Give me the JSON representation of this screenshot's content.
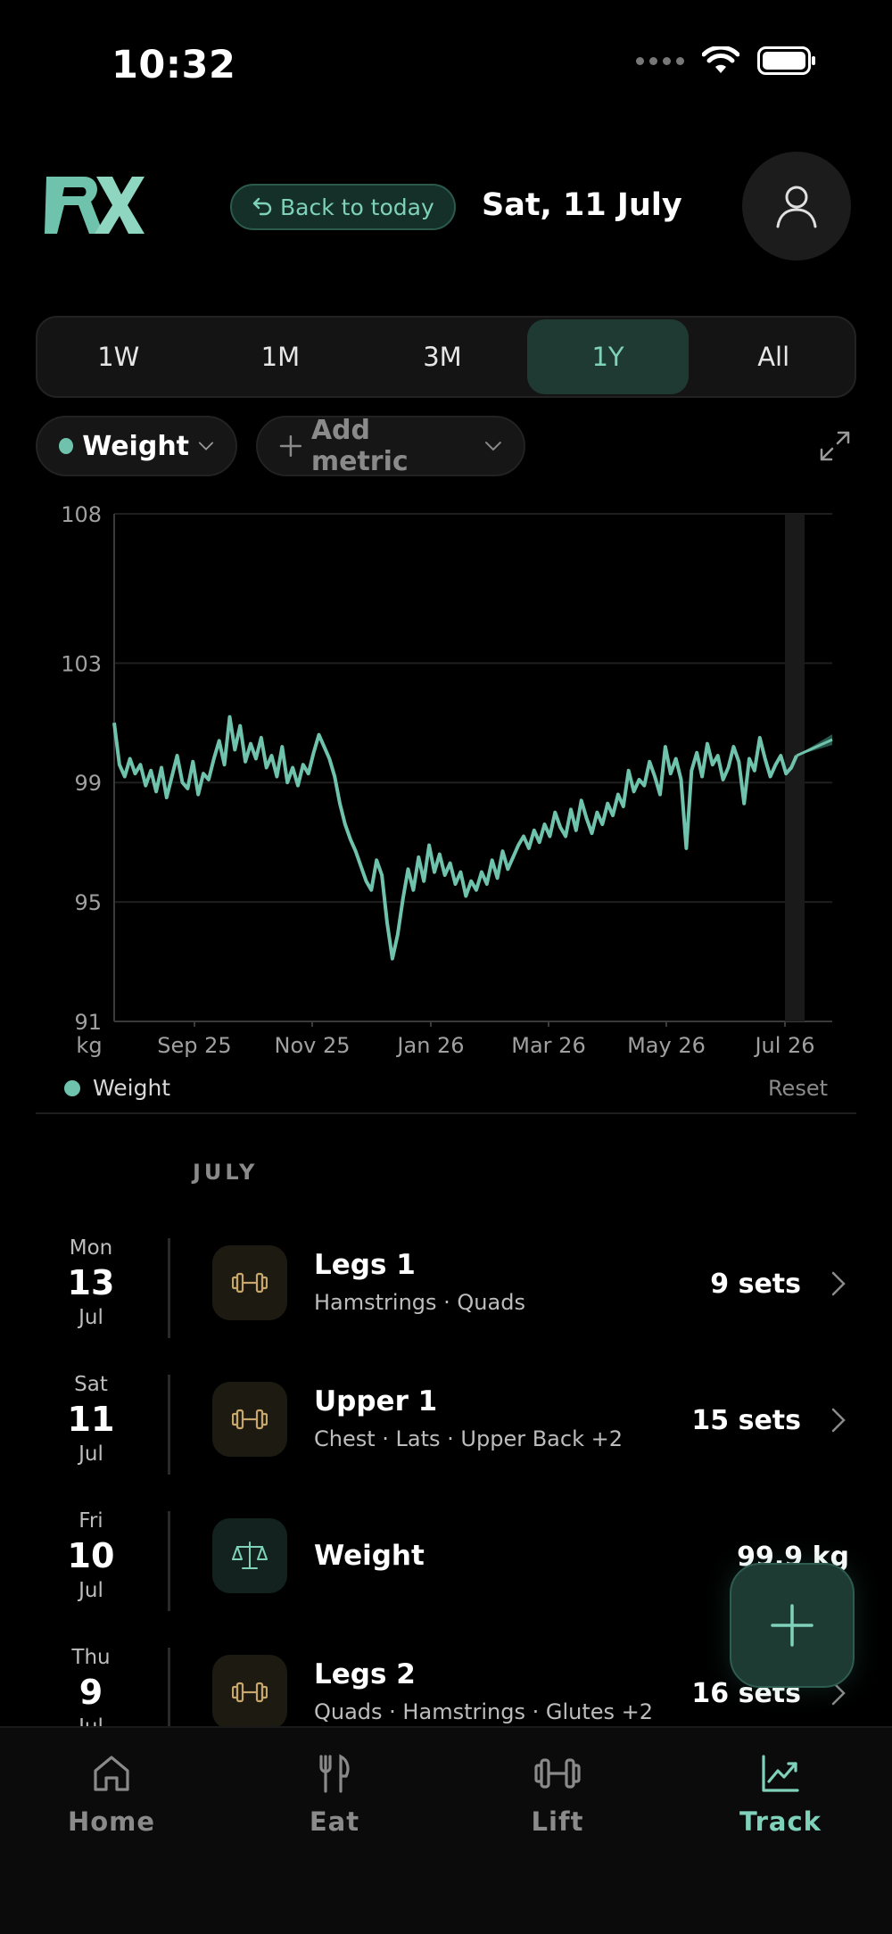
{
  "status_bar": {
    "time": "10:32"
  },
  "header": {
    "back_to_today": "Back to today",
    "date": "Sat, 11 July"
  },
  "range_tabs": [
    {
      "label": "1W",
      "active": false
    },
    {
      "label": "1M",
      "active": false
    },
    {
      "label": "3M",
      "active": false
    },
    {
      "label": "1Y",
      "active": true
    },
    {
      "label": "All",
      "active": false
    }
  ],
  "metrics": {
    "selected": "Weight",
    "add_label": "Add metric"
  },
  "chart_data": {
    "type": "line",
    "title": "",
    "xlabel": "",
    "ylabel": "kg",
    "ylim": [
      91,
      108
    ],
    "yticks": [
      "108",
      "103",
      "99",
      "95",
      "91"
    ],
    "xticks": [
      "Sep 25",
      "Nov 25",
      "Jan 26",
      "Mar 26",
      "May 26",
      "Jul 26"
    ],
    "grid": true,
    "legend": "bottom-left",
    "series": [
      {
        "name": "Weight",
        "color": "#6fc3ac",
        "values": [
          101.0,
          99.6,
          99.2,
          99.8,
          99.3,
          99.6,
          98.9,
          99.4,
          98.7,
          99.5,
          98.5,
          99.2,
          99.9,
          99.0,
          98.8,
          99.7,
          98.6,
          99.3,
          99.1,
          99.8,
          100.4,
          99.6,
          101.2,
          100.1,
          100.9,
          99.7,
          100.3,
          99.8,
          100.5,
          99.5,
          99.9,
          99.2,
          100.2,
          99.0,
          99.5,
          98.9,
          99.6,
          99.3,
          100.0,
          100.6,
          100.2,
          99.8,
          99.2,
          98.3,
          97.6,
          97.1,
          96.7,
          96.2,
          95.7,
          95.4,
          96.4,
          95.9,
          94.3,
          93.1,
          93.9,
          95.1,
          96.1,
          95.4,
          96.5,
          95.7,
          96.9,
          96.0,
          96.6,
          95.9,
          96.3,
          95.6,
          96.0,
          95.2,
          95.7,
          95.4,
          96.0,
          95.6,
          96.4,
          95.8,
          96.7,
          96.1,
          96.5,
          96.9,
          97.2,
          96.8,
          97.4,
          97.0,
          97.6,
          97.2,
          98.0,
          97.5,
          97.2,
          98.1,
          97.4,
          98.4,
          97.8,
          97.3,
          98.0,
          97.6,
          98.3,
          97.9,
          98.6,
          98.2,
          99.4,
          98.7,
          99.1,
          98.9,
          99.7,
          99.2,
          98.6,
          100.2,
          99.3,
          99.8,
          99.1,
          96.8,
          99.4,
          100.0,
          99.2,
          100.3,
          99.6,
          99.9,
          99.1,
          99.5,
          100.2,
          99.7,
          98.3,
          99.8,
          99.4,
          100.5,
          99.8,
          99.2,
          99.6,
          99.9,
          99.3,
          99.5,
          99.9
        ]
      }
    ],
    "reset_label": "Reset"
  },
  "month_label": "JULY",
  "entries": [
    {
      "dow": "Mon",
      "day": "13",
      "mon": "Jul",
      "type": "lift",
      "title": "Legs 1",
      "subtitle": "Hamstrings · Quads",
      "value": "9 sets"
    },
    {
      "dow": "Sat",
      "day": "11",
      "mon": "Jul",
      "type": "lift",
      "title": "Upper 1",
      "subtitle": "Chest · Lats · Upper Back +2",
      "value": "15 sets"
    },
    {
      "dow": "Fri",
      "day": "10",
      "mon": "Jul",
      "type": "weight",
      "title": "Weight",
      "subtitle": "",
      "value": "99.9 kg"
    },
    {
      "dow": "Thu",
      "day": "9",
      "mon": "Jul",
      "type": "lift",
      "title": "Legs 2",
      "subtitle": "Quads · Hamstrings · Glutes +2",
      "value": "16 sets"
    }
  ],
  "nav": [
    {
      "label": "Home",
      "icon": "home-icon",
      "active": false
    },
    {
      "label": "Eat",
      "icon": "fork-knife-icon",
      "active": false
    },
    {
      "label": "Lift",
      "icon": "dumbbell-icon",
      "active": false
    },
    {
      "label": "Track",
      "icon": "chart-icon",
      "active": true
    }
  ],
  "colors": {
    "accent": "#7fd1b9",
    "line": "#6fc3ac",
    "background": "#000000"
  }
}
